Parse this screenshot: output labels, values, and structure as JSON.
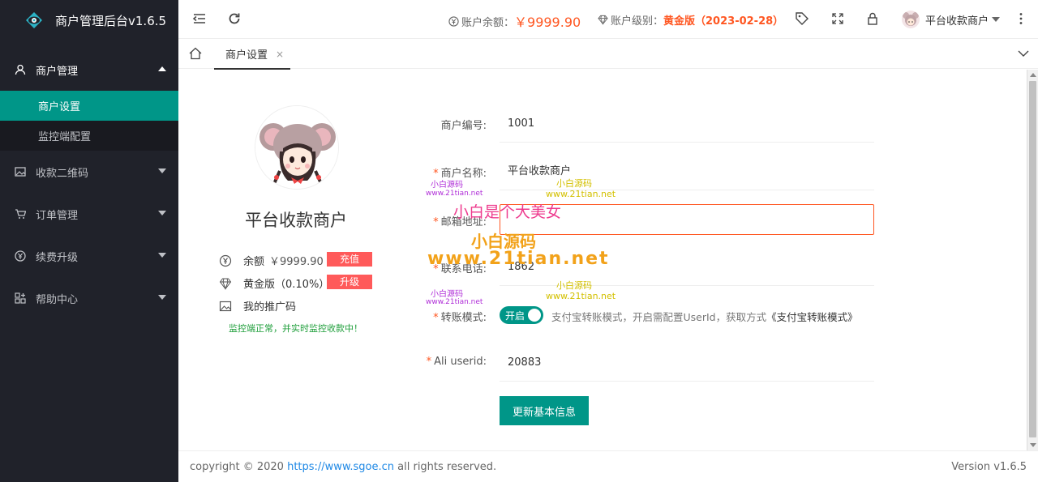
{
  "app": {
    "title": "商户管理后台v1.6.5"
  },
  "sidebar": {
    "items": [
      {
        "label": "商户管理",
        "sub": [
          {
            "label": "商户设置"
          },
          {
            "label": "监控端配置"
          }
        ]
      },
      {
        "label": "收款二维码"
      },
      {
        "label": "订单管理"
      },
      {
        "label": "续费升级"
      },
      {
        "label": "帮助中心"
      }
    ]
  },
  "header": {
    "balance_label": "账户余额：",
    "balance_value": "￥9999.90",
    "level_label": "账户级别：",
    "level_value": "黄金版（2023-02-28）",
    "user_name": "平台收款商户"
  },
  "tabs": [
    {
      "label": "商户设置",
      "close": "×"
    }
  ],
  "profile": {
    "name": "平台收款商户",
    "balance_label": "余额",
    "balance_value": "￥9999.90",
    "recharge_label": "充值",
    "level_text": "黄金版（0.10%）",
    "upgrade_label": "升级",
    "promo_label": "我的推广码",
    "monitor_status": "监控端正常，并实时监控收款中！"
  },
  "form": {
    "merchant_id_label": "商户编号:",
    "merchant_id_value": "1001",
    "merchant_name_label": "商户名称:",
    "merchant_name_value": "平台收款商户",
    "email_label": "邮箱地址:",
    "email_value": "",
    "phone_label": "联系电话:",
    "phone_value": "1862",
    "transfer_label": "转账模式:",
    "transfer_switch": "开启",
    "transfer_hint": "支付宝转账模式，开启需配置UserId，获取方式",
    "transfer_link": "《支付宝转账模式》",
    "ali_label": "Ali userid:",
    "ali_value": "20883",
    "submit_label": "更新基本信息"
  },
  "watermarks": {
    "small_cn": "小白源码",
    "small_url": "www.21tian.net",
    "big_cn": "小白源码",
    "big_url": "www.21tian.net",
    "pink": "小白是个大美女"
  },
  "footer": {
    "copyright_prefix": "copyright © 2020 ",
    "link": "https://www.sgoe.cn",
    "copyright_suffix": " all rights reserved.",
    "version": "Version v1.6.5"
  },
  "colors": {
    "accent": "#009688",
    "sidebar": "#20222a",
    "warn": "#ff5722",
    "badge": "#ff5a5a"
  }
}
